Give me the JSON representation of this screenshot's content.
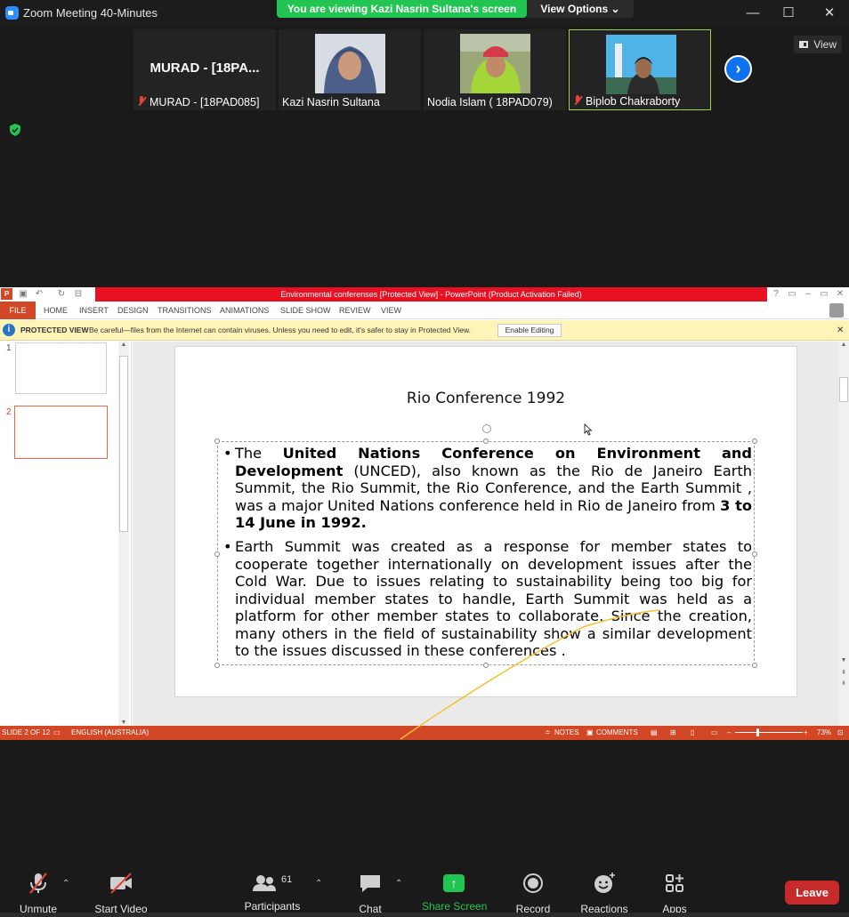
{
  "window": {
    "title": "Zoom Meeting 40-Minutes"
  },
  "banner": {
    "viewing": "You are viewing Kazi Nasrin Sultana's screen",
    "view_options": "View Options"
  },
  "window_controls": {
    "minimize": "—",
    "maximize": "☐",
    "close": "✕"
  },
  "participants": [
    {
      "big_name": "MURAD - [18PA...",
      "name": "MURAD - [18PAD085]",
      "muted": true
    },
    {
      "name": "Kazi Nasrin Sultana",
      "muted": false
    },
    {
      "name": "Nodia Islam ( 18PAD079)",
      "muted": false
    },
    {
      "name": "Biplob Chakraborty",
      "muted": true
    }
  ],
  "view_button": {
    "label": "View"
  },
  "ppt": {
    "title": "Environmental conferenses [Protected View] - PowerPoint (Product Activation Failed)",
    "tabs": [
      "FILE",
      "HOME",
      "INSERT",
      "DESIGN",
      "TRANSITIONS",
      "ANIMATIONS",
      "SLIDE SHOW",
      "REVIEW",
      "VIEW"
    ],
    "protected_view": {
      "label": "PROTECTED VIEW",
      "message": "Be careful—files from the Internet can contain viruses. Unless you need to edit, it's safer to stay in Protected View.",
      "button": "Enable Editing"
    },
    "thumbnails": [
      "1",
      "2"
    ],
    "slide": {
      "title": "Rio Conference 1992",
      "bullet1": {
        "t1": "The ",
        "b1": "United Nations Conference on Environment and Development",
        "t2": " (UNCED), also known as the Rio de Janeiro Earth Summit, the Rio Summit, the Rio Conference, and the Earth Summit , was a major United Nations conference held in Rio de Janeiro from ",
        "b2": "3 to 14 June in 1992."
      },
      "bullet2": "Earth Summit was created as a response for member states to cooperate together internationally on development issues after the Cold War. Due to issues relating to sustainability being too big for individual member states to handle, Earth Summit was held as a platform for other member states to collaborate. Since the creation, many others in the field of sustainability show a similar development to the issues discussed in these conferences ."
    },
    "status": {
      "slide": "SLIDE 2 OF 12",
      "language": "ENGLISH (AUSTRALIA)",
      "notes": "NOTES",
      "comments": "COMMENTS",
      "zoom": "73%"
    }
  },
  "toolbar": {
    "unmute": "Unmute",
    "start_video": "Start Video",
    "participants": "Participants",
    "participants_count": "61",
    "chat": "Chat",
    "share_screen": "Share Screen",
    "record": "Record",
    "reactions": "Reactions",
    "apps": "Apps",
    "leave": "Leave"
  },
  "colors": {
    "share_green": "#23c552",
    "leave_red": "#c62a2a",
    "ppt_orange": "#d24726",
    "zoom_blue": "#0e72ed"
  }
}
